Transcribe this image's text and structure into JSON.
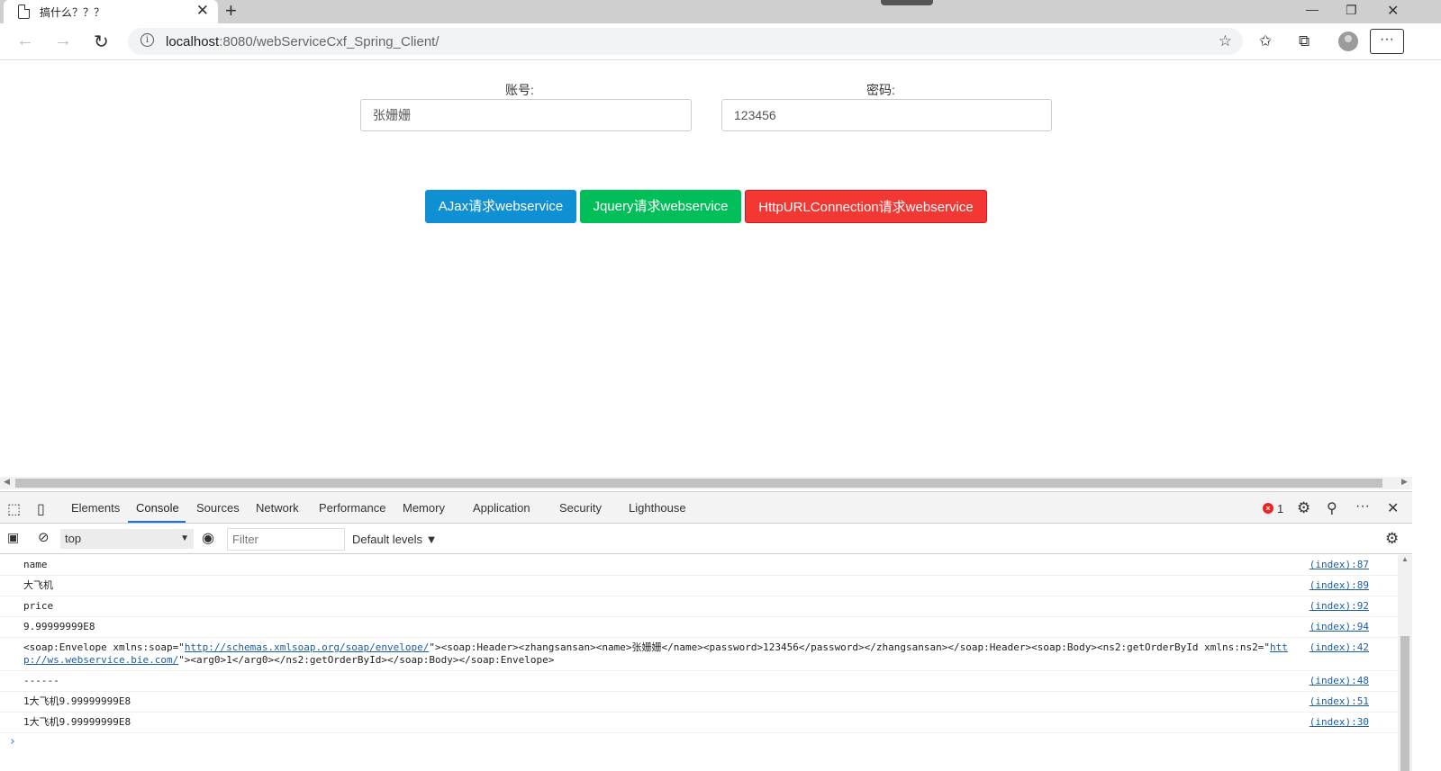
{
  "browser": {
    "tab_title": "搞什么？？？",
    "tab_close": "✕",
    "new_tab": "+",
    "url_host": "localhost",
    "url_rest": ":8080/webServiceCxf_Spring_Client/"
  },
  "form": {
    "account_label": "账号:",
    "account_value": "张姗姗",
    "password_label": "密码:",
    "password_value": "123456"
  },
  "buttons": {
    "ajax": "AJax请求webservice",
    "jquery": "Jquery请求webservice",
    "http": "HttpURLConnection请求webservice"
  },
  "devtools": {
    "tabs": [
      "Elements",
      "Console",
      "Sources",
      "Network",
      "Performance",
      "Memory",
      "Application",
      "Security",
      "Lighthouse"
    ],
    "active_tab": "Console",
    "error_count": "1",
    "context": "top",
    "filter_placeholder": "Filter",
    "levels": "Default levels ▼",
    "messages": [
      {
        "text": "name",
        "source": "(index):87"
      },
      {
        "text": "大飞机",
        "source": "(index):89"
      },
      {
        "text": "price",
        "source": "(index):92"
      },
      {
        "text": "9.99999999E8",
        "source": "(index):94"
      },
      {
        "text_parts": [
          "<soap:Envelope xmlns:soap=\"",
          "http://schemas.xmlsoap.org/soap/envelope/",
          "\"><soap:Header><zhangsansan><name>张姗姗</name><password>123456</password></zhangsansan></soap:Header><soap:Body><ns2:getOrderById xmlns:ns2=\"",
          "http://ws.webservice.bie.com/",
          "\"><arg0>1</arg0></ns2:getOrderById></soap:Body></soap:Envelope>"
        ],
        "source": "(index):42"
      },
      {
        "text": "------",
        "source": "(index):48"
      },
      {
        "text": "1大飞机9.99999999E8",
        "source": "(index):51"
      },
      {
        "text": "1大飞机9.99999999E8",
        "source": "(index):30"
      }
    ]
  }
}
